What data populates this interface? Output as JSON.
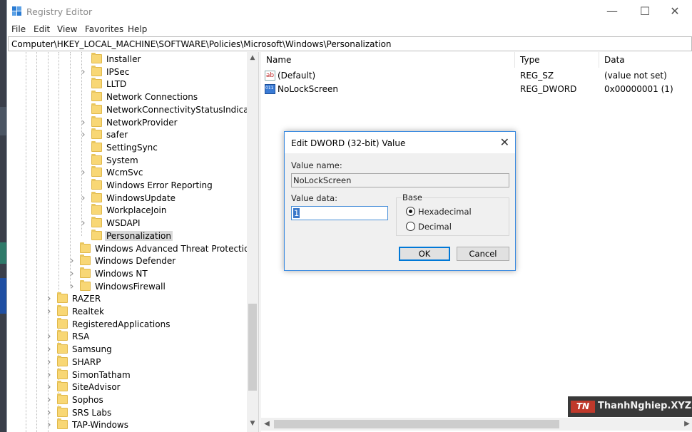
{
  "window": {
    "title": "Registry Editor"
  },
  "titlebar": {
    "minimize": "—",
    "maximize": "☐",
    "close": "✕"
  },
  "menu": [
    "File",
    "Edit",
    "View",
    "Favorites",
    "Help"
  ],
  "address": "Computer\\HKEY_LOCAL_MACHINE\\SOFTWARE\\Policies\\Microsoft\\Windows\\Personalization",
  "tree": {
    "items": [
      {
        "label": "Installer",
        "expandable": false,
        "level": 3
      },
      {
        "label": "IPSec",
        "expandable": true,
        "level": 3
      },
      {
        "label": "LLTD",
        "expandable": false,
        "level": 3
      },
      {
        "label": "Network Connections",
        "expandable": false,
        "level": 3
      },
      {
        "label": "NetworkConnectivityStatusIndicator",
        "expandable": false,
        "level": 3
      },
      {
        "label": "NetworkProvider",
        "expandable": true,
        "level": 3
      },
      {
        "label": "safer",
        "expandable": true,
        "level": 3
      },
      {
        "label": "SettingSync",
        "expandable": false,
        "level": 3
      },
      {
        "label": "System",
        "expandable": false,
        "level": 3
      },
      {
        "label": "WcmSvc",
        "expandable": true,
        "level": 3
      },
      {
        "label": "Windows Error Reporting",
        "expandable": false,
        "level": 3
      },
      {
        "label": "WindowsUpdate",
        "expandable": true,
        "level": 3
      },
      {
        "label": "WorkplaceJoin",
        "expandable": false,
        "level": 3
      },
      {
        "label": "WSDAPI",
        "expandable": true,
        "level": 3
      },
      {
        "label": "Personalization",
        "expandable": false,
        "level": 3,
        "selected": true
      },
      {
        "label": "Windows Advanced Threat Protection",
        "expandable": false,
        "level": 2
      },
      {
        "label": "Windows Defender",
        "expandable": true,
        "level": 2
      },
      {
        "label": "Windows NT",
        "expandable": true,
        "level": 2
      },
      {
        "label": "WindowsFirewall",
        "expandable": true,
        "level": 2
      },
      {
        "label": "RAZER",
        "expandable": true,
        "level": 1
      },
      {
        "label": "Realtek",
        "expandable": true,
        "level": 1
      },
      {
        "label": "RegisteredApplications",
        "expandable": false,
        "level": 1
      },
      {
        "label": "RSA",
        "expandable": true,
        "level": 1
      },
      {
        "label": "Samsung",
        "expandable": true,
        "level": 1
      },
      {
        "label": "SHARP",
        "expandable": true,
        "level": 1
      },
      {
        "label": "SimonTatham",
        "expandable": true,
        "level": 1
      },
      {
        "label": "SiteAdvisor",
        "expandable": true,
        "level": 1
      },
      {
        "label": "Sophos",
        "expandable": true,
        "level": 1
      },
      {
        "label": "SRS Labs",
        "expandable": true,
        "level": 1
      },
      {
        "label": "TAP-Windows",
        "expandable": true,
        "level": 1
      }
    ]
  },
  "list": {
    "columns": {
      "name": "Name",
      "type": "Type",
      "data": "Data"
    },
    "rows": [
      {
        "name": "(Default)",
        "type": "REG_SZ",
        "data": "(value not set)",
        "icon": "string-value-icon"
      },
      {
        "name": "NoLockScreen",
        "type": "REG_DWORD",
        "data": "0x00000001 (1)",
        "icon": "binary-value-icon"
      }
    ]
  },
  "dialog": {
    "title": "Edit DWORD (32-bit) Value",
    "value_name_label": "Value name:",
    "value_name": "NoLockScreen",
    "value_data_label": "Value data:",
    "value_data": "1",
    "base_label": "Base",
    "hex_label": "Hexadecimal",
    "dec_label": "Decimal",
    "base_selected": "Hexadecimal",
    "ok_label": "OK",
    "cancel_label": "Cancel"
  },
  "watermark": {
    "logo": "TN",
    "text": "ThanhNghiep.XYZ"
  },
  "colors": {
    "accent": "#0078d7",
    "folder": "#f8d775"
  }
}
